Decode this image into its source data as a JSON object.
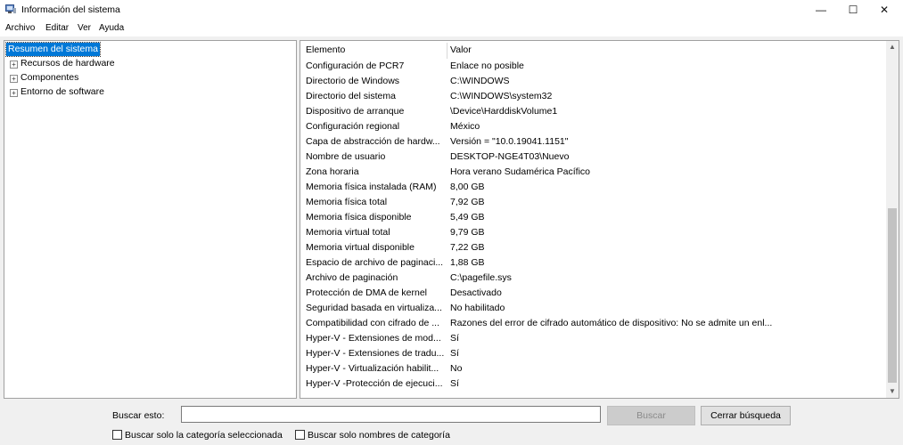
{
  "window": {
    "title": "Información del sistema",
    "controls": {
      "minimize": "—",
      "maximize": "☐",
      "close": "✕"
    }
  },
  "menu": [
    "Archivo",
    "Editar",
    "Ver",
    "Ayuda"
  ],
  "tree": {
    "root": "Resumen del sistema",
    "children": [
      {
        "label": "Recursos de hardware",
        "expander": "+"
      },
      {
        "label": "Componentes",
        "expander": "+"
      },
      {
        "label": "Entorno de software",
        "expander": "+"
      }
    ]
  },
  "table": {
    "columns": [
      "Elemento",
      "Valor"
    ],
    "rows": [
      {
        "name": "Configuración de PCR7",
        "value": "Enlace no posible"
      },
      {
        "name": "Directorio de Windows",
        "value": "C:\\WINDOWS"
      },
      {
        "name": "Directorio del sistema",
        "value": "C:\\WINDOWS\\system32"
      },
      {
        "name": "Dispositivo de arranque",
        "value": "\\Device\\HarddiskVolume1"
      },
      {
        "name": "Configuración regional",
        "value": "México"
      },
      {
        "name": "Capa de abstracción de hardw...",
        "value": "Versión = \"10.0.19041.1151\""
      },
      {
        "name": "Nombre de usuario",
        "value": "DESKTOP-NGE4T03\\Nuevo"
      },
      {
        "name": "Zona horaria",
        "value": "Hora verano Sudamérica Pacífico"
      },
      {
        "name": "Memoria física instalada (RAM)",
        "value": "8,00 GB"
      },
      {
        "name": "Memoria física total",
        "value": "7,92 GB"
      },
      {
        "name": "Memoria física disponible",
        "value": "5,49 GB"
      },
      {
        "name": "Memoria virtual total",
        "value": "9,79 GB"
      },
      {
        "name": "Memoria virtual disponible",
        "value": "7,22 GB"
      },
      {
        "name": "Espacio de archivo de paginaci...",
        "value": "1,88 GB"
      },
      {
        "name": "Archivo de paginación",
        "value": "C:\\pagefile.sys"
      },
      {
        "name": "Protección de DMA de kernel",
        "value": "Desactivado"
      },
      {
        "name": "Seguridad basada en virtualiza...",
        "value": "No habilitado"
      },
      {
        "name": "Compatibilidad con cifrado de ...",
        "value": "Razones del error de cifrado automático de dispositivo: No se admite un enl..."
      },
      {
        "name": "Hyper-V - Extensiones de mod...",
        "value": "Sí"
      },
      {
        "name": "Hyper-V - Extensiones de tradu...",
        "value": "Sí"
      },
      {
        "name": "Hyper-V - Virtualización habilit...",
        "value": "No"
      },
      {
        "name": "Hyper-V -Protección de ejecuci...",
        "value": "Sí"
      }
    ]
  },
  "scrollbar": {
    "up": "▲",
    "down": "▼"
  },
  "search": {
    "label": "Buscar esto:",
    "value": "",
    "find_button": "Buscar",
    "close_button": "Cerrar búsqueda",
    "option_selected_category": "Buscar solo la categoría seleccionada",
    "option_category_names": "Buscar solo nombres de categoría"
  }
}
